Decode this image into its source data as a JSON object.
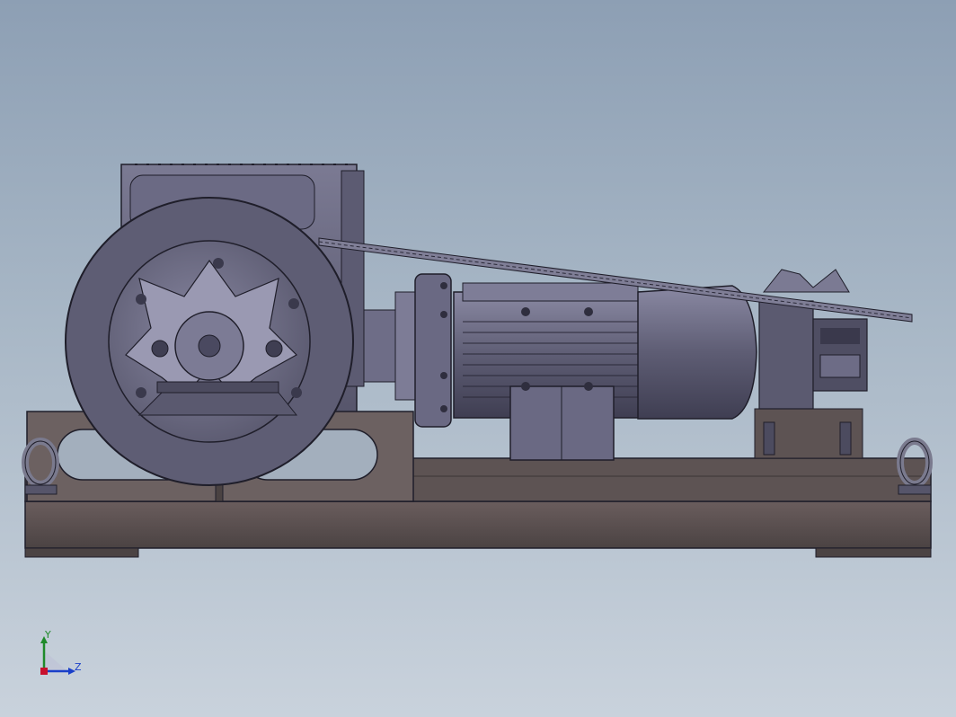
{
  "viewport": {
    "background_top": "#8d9fb4",
    "background_bottom": "#c9d2dc",
    "model_color": "#6f6e86",
    "edge_color": "#1f1e2a"
  },
  "model": {
    "name": "drum-hoist-assembly",
    "components": [
      "winch-drum",
      "gear-reducer",
      "coupling",
      "electric-motor",
      "brake-unit",
      "wire-rope",
      "base-frame",
      "lifting-eye-left",
      "lifting-eye-right"
    ]
  },
  "triad": {
    "y_label": "Y",
    "z_label": "Z",
    "y_color": "#1f8a2a",
    "z_color": "#1a3fc9"
  }
}
